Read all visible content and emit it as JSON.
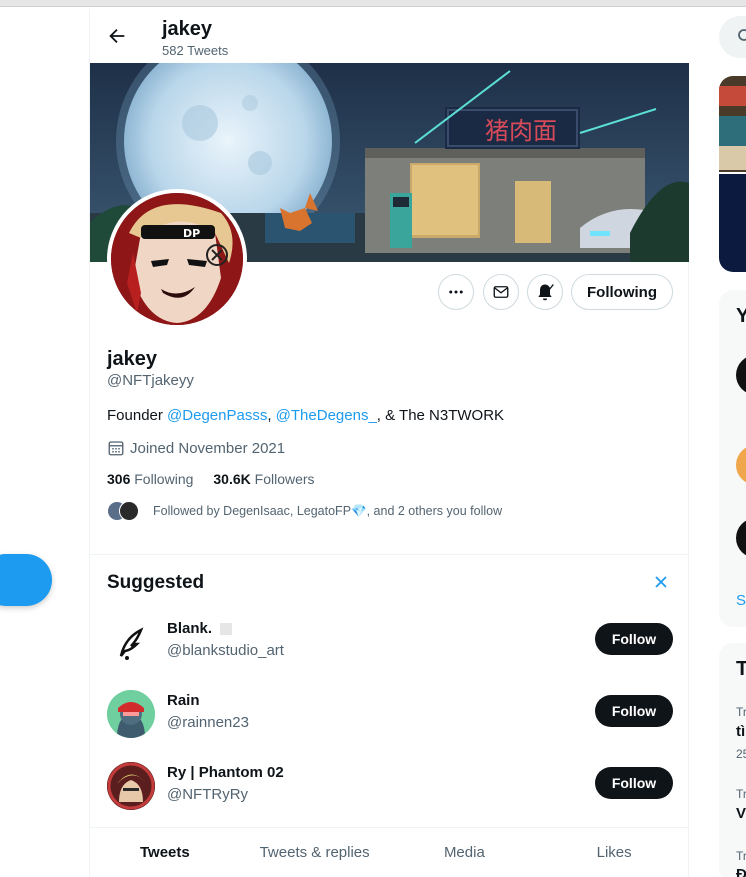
{
  "header": {
    "name": "jakey",
    "tweet_count": "582 Tweets"
  },
  "profile": {
    "name": "jakey",
    "handle": "@NFTjakeyy",
    "bio_prefix": "Founder ",
    "bio_mention1": "@DegenPasss",
    "bio_sep1": ", ",
    "bio_mention2": "@TheDegens_",
    "bio_suffix": ", & The N3TWORK",
    "joined": "Joined November 2021",
    "following_count": "306",
    "following_label": "Following",
    "followers_count": "30.6K",
    "followers_label": "Followers",
    "followed_by": "Followed by DegenIsaac, LegatoFP💎, and 2 others you follow",
    "follow_state_label": "Following"
  },
  "banner": {
    "sign_text": "猪肉面"
  },
  "suggested": {
    "title": "Suggested",
    "items": [
      {
        "name": "Blank.",
        "handle": "@blankstudio_art",
        "button": "Follow"
      },
      {
        "name": "Rain",
        "handle": "@rainnen23",
        "button": "Follow"
      },
      {
        "name": "Ry | Phantom 02",
        "handle": "@NFTRyRy",
        "button": "Follow"
      }
    ]
  },
  "tabs": [
    "Tweets",
    "Tweets & replies",
    "Media",
    "Likes"
  ],
  "right_sidebar": {
    "heading1_fragment": "Y",
    "show_more_fragment": "S",
    "heading2_fragment": "T",
    "trend_label_fragment1": "Tr",
    "trend_text_fragment1": "tì",
    "trend_count_fragment1": "25",
    "trend_label_fragment2": "Tr",
    "trend_text_fragment2": "V",
    "trend_label_fragment3": "Tr",
    "trend_text_fragment3": "Đ"
  },
  "colors": {
    "accent": "#1d9bf0",
    "text": "#0f1419",
    "muted": "#536471"
  }
}
